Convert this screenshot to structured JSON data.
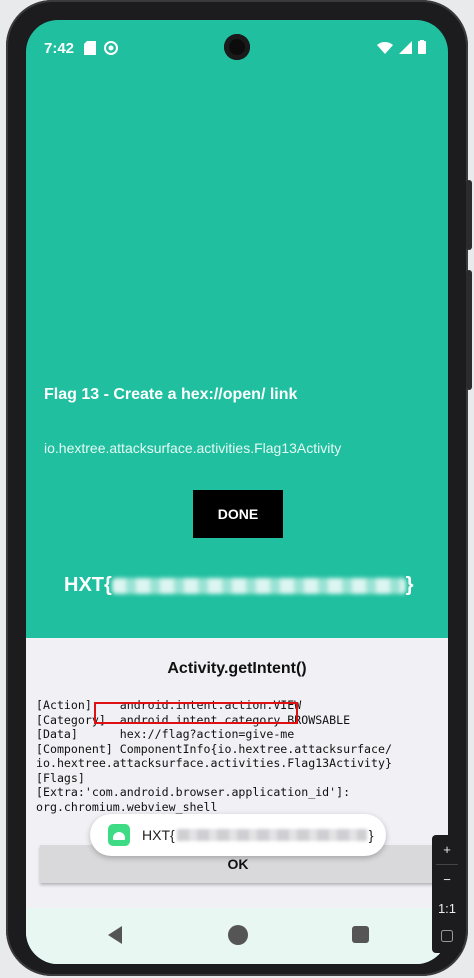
{
  "status_bar": {
    "time": "7:42"
  },
  "app": {
    "flag_title": "Flag 13 - Create a hex://open/ link",
    "activity_name": "io.hextree.attacksurface.activities.Flag13Activity",
    "done_label": "DONE",
    "flag_prefix": "HXT{",
    "flag_suffix": "}"
  },
  "dialog": {
    "title": "Activity.getIntent()",
    "lines": [
      "[Action]    android.intent.action.VIEW",
      "[Category]  android.intent.category.BROWSABLE",
      "[Data]      hex://flag?action=give-me",
      "[Component] ComponentInfo{io.hextree.attacksurface/",
      "io.hextree.attacksurface.activities.Flag13Activity}",
      "[Flags]",
      "[Extra:'com.android.browser.application_id']:",
      "org.chromium.webview_shell"
    ],
    "ok_label": "OK"
  },
  "toast": {
    "prefix": "HXT{",
    "suffix": "}"
  },
  "zoom_controls": {
    "zoom_in": "+",
    "zoom_out": "−",
    "ratio": "1:1"
  },
  "colors": {
    "accent": "#1fbf9f",
    "highlight": "#d11111"
  }
}
